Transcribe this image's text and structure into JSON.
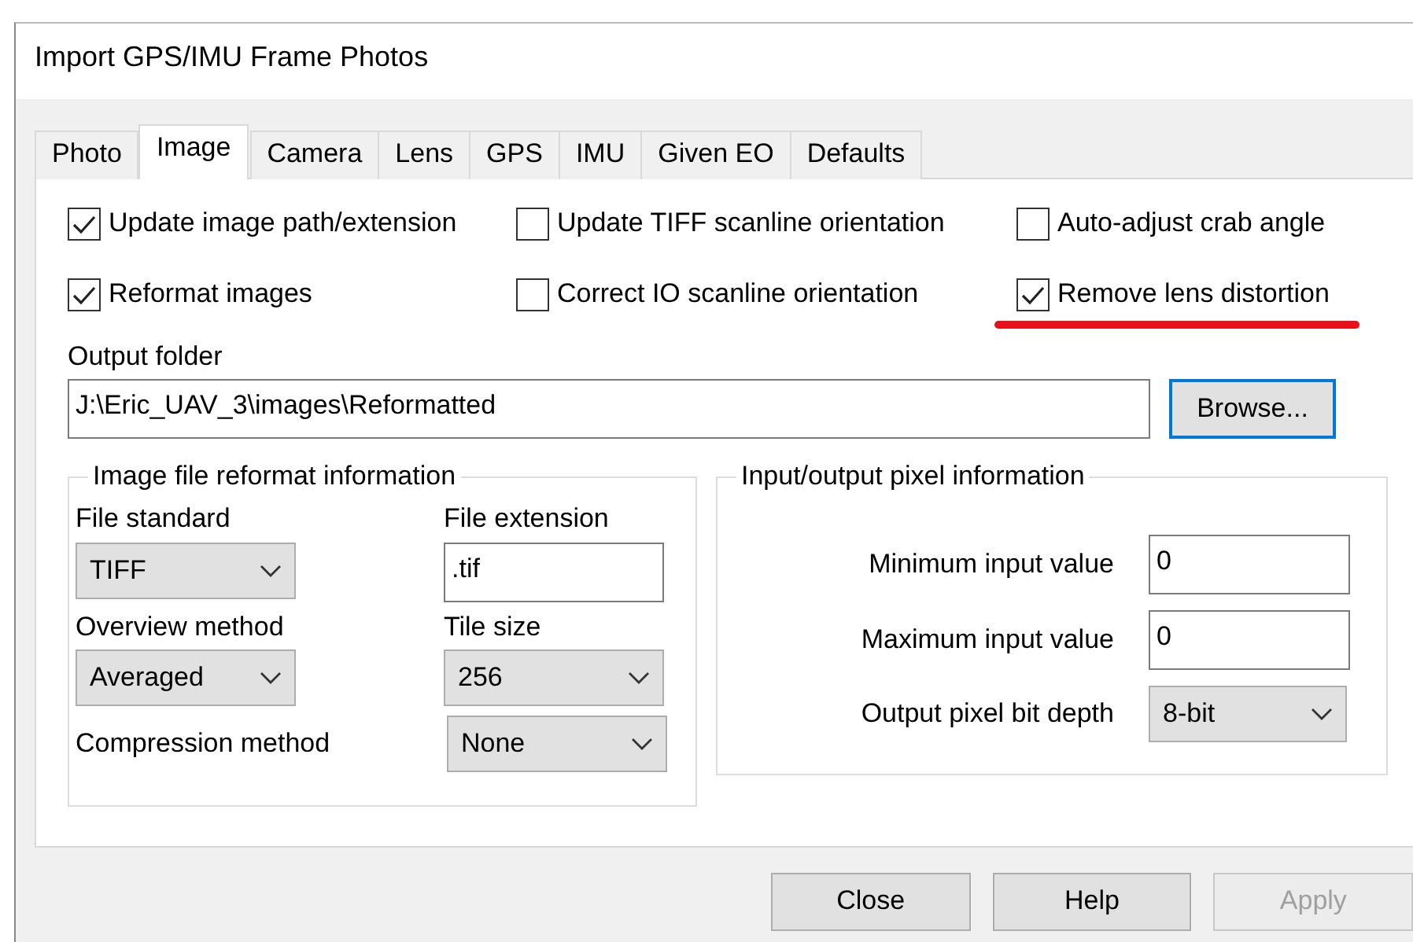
{
  "window": {
    "title": "Import GPS/IMU Frame Photos"
  },
  "tabs": [
    {
      "label": "Photo",
      "selected": false
    },
    {
      "label": "Image",
      "selected": true
    },
    {
      "label": "Camera",
      "selected": false
    },
    {
      "label": "Lens",
      "selected": false
    },
    {
      "label": "GPS",
      "selected": false
    },
    {
      "label": "IMU",
      "selected": false
    },
    {
      "label": "Given EO",
      "selected": false
    },
    {
      "label": "Defaults",
      "selected": false
    }
  ],
  "options": [
    {
      "label": "Update image path/extension",
      "checked": true,
      "underlined": false
    },
    {
      "label": "Update TIFF scanline orientation",
      "checked": false,
      "underlined": false
    },
    {
      "label": "Auto-adjust crab angle",
      "checked": false,
      "underlined": false
    },
    {
      "label": "Reformat images",
      "checked": true,
      "underlined": false
    },
    {
      "label": "Correct IO scanline orientation",
      "checked": false,
      "underlined": false
    },
    {
      "label": "Remove lens distortion",
      "checked": true,
      "underlined": true
    }
  ],
  "output_folder": {
    "label": "Output folder",
    "value": "J:\\Eric_UAV_3\\images\\Reformatted",
    "browse": {
      "label": "Browse...",
      "focused": true
    }
  },
  "reformat_group": {
    "title": "Image file reformat information",
    "fields": [
      {
        "label": "File standard",
        "kind": "select",
        "value": "TIFF"
      },
      {
        "label": "File extension",
        "kind": "text",
        "value": ".tif"
      },
      {
        "label": "Overview method",
        "kind": "select",
        "value": "Averaged"
      },
      {
        "label": "Tile size",
        "kind": "select",
        "value": "256"
      },
      {
        "label": "Compression method",
        "kind": "select",
        "value": "None"
      }
    ]
  },
  "pixel_group": {
    "title": "Input/output pixel information",
    "fields": [
      {
        "label": "Minimum input value",
        "kind": "text",
        "value": "0"
      },
      {
        "label": "Maximum input value",
        "kind": "text",
        "value": "0"
      },
      {
        "label": "Output pixel bit depth",
        "kind": "select",
        "value": "8-bit"
      }
    ]
  },
  "buttons": [
    {
      "label": "Close",
      "disabled": false
    },
    {
      "label": "Help",
      "disabled": false
    },
    {
      "label": "Apply",
      "disabled": true
    }
  ]
}
